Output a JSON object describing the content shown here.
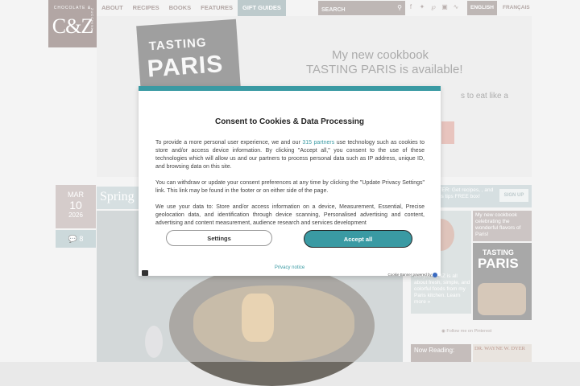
{
  "header": {
    "logo_top": "CHOCOLATE &",
    "logo_main": "C&Z",
    "logo_side": "ZUCCHINI",
    "nav": [
      "ABOUT",
      "RECIPES",
      "BOOKS",
      "FEATURES",
      "GIFT GUIDES"
    ],
    "search_placeholder": "SEARCH",
    "lang_en": "ENGLISH",
    "lang_fr": "FRANÇAIS"
  },
  "hero": {
    "book_line1": "TASTING",
    "book_line2": "PARIS",
    "line1": "My new cookbook",
    "line2": "TASTING PARIS is available!",
    "sub": "s to eat like a"
  },
  "article": {
    "month": "MAR",
    "day": "10",
    "year": "2026",
    "comments": "8",
    "title": "Spring"
  },
  "sidebar": {
    "newsletter_text": "ETTER: Get recipes, , and Paris tips FREE box!",
    "signup": "SIGN UP",
    "promo": "My new cookbook celebrating the wonderful flavors of Paris!",
    "book_line1": "TASTING",
    "book_line2": "PARIS",
    "author_text": "Bonjour! C&Z is all about fresh, simple, and colorful foods from my Paris kitchen. Learn more »",
    "pinterest": "Follow me on Pinterest",
    "now_reading": "Now Reading:",
    "drbook": "DR. WAYNE W. DYER"
  },
  "consent": {
    "title": "Consent to Cookies & Data Processing",
    "p1_before": "To provide a more personal user experience, we and our ",
    "p1_link": "315 partners",
    "p1_after": " use technology such as cookies to store and/or access device information. By clicking \"Accept all,\" you consent to the use of these technologies which will allow us and our partners to process personal data such as IP address, unique ID, and browsing data on this site.",
    "p2": "You can withdraw or update your consent preferences at any time by clicking the \"Update Privacy Settings\" link. This link may be found in the footer or on either side of the page.",
    "p3": "We use your data to: Store and/or access information on a device, Measurement, Essential, Precise geolocation data, and identification through device scanning, Personalised advertising and content, advertising and content measurement, audience research and services development",
    "settings_label": "Settings",
    "accept_label": "Accept all",
    "privacy_label": "Privacy notice",
    "powered_by": "Cookie Banner powered by"
  }
}
